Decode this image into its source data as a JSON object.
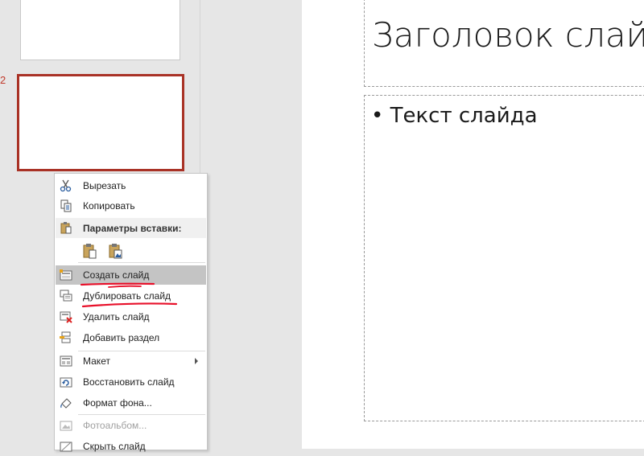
{
  "thumbnails": {
    "slide2_number": "2"
  },
  "slide": {
    "title": "Заголовок слайд",
    "bullet": "• Текст слайда"
  },
  "menu": {
    "cut": "Вырезать",
    "copy": "Копировать",
    "paste_options": "Параметры вставки:",
    "new_slide": "Создать слайд",
    "duplicate_slide": "Дублировать слайд",
    "delete_slide": "Удалить слайд",
    "add_section": "Добавить раздел",
    "layout": "Макет",
    "reset_slide": "Восстановить слайд",
    "format_background": "Формат фона...",
    "photo_album": "Фотоальбом...",
    "hide_slide": "Скрыть слайд"
  },
  "colors": {
    "selection_border": "#a93226",
    "annotation_red": "#e8102a",
    "highlight": "#c4c4c4"
  }
}
